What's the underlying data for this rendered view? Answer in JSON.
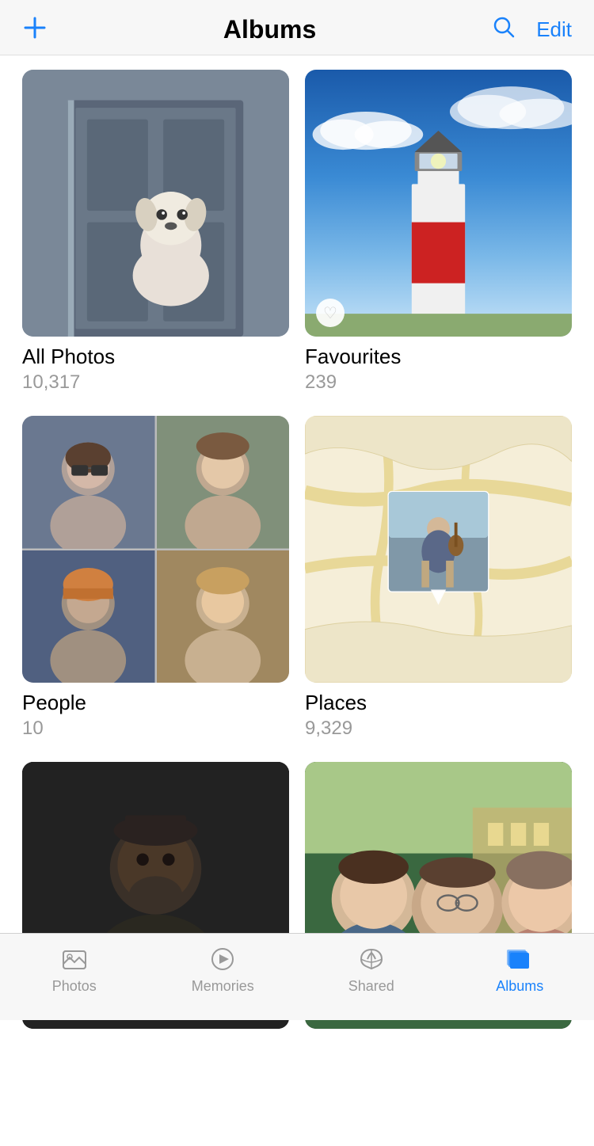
{
  "header": {
    "title": "Albums",
    "add_label": "+",
    "edit_label": "Edit"
  },
  "albums": [
    {
      "id": "all-photos",
      "name": "All Photos",
      "count": "10,317",
      "type": "dog"
    },
    {
      "id": "favourites",
      "name": "Favourites",
      "count": "239",
      "type": "lighthouse",
      "badge": "heart"
    },
    {
      "id": "people",
      "name": "People",
      "count": "10",
      "type": "people"
    },
    {
      "id": "places",
      "name": "Places",
      "count": "9,329",
      "type": "places"
    },
    {
      "id": "album5",
      "name": "",
      "count": "",
      "type": "dark"
    },
    {
      "id": "album6",
      "name": "",
      "count": "",
      "type": "group"
    }
  ],
  "tabs": [
    {
      "id": "photos",
      "label": "Photos",
      "active": false
    },
    {
      "id": "memories",
      "label": "Memories",
      "active": false
    },
    {
      "id": "shared",
      "label": "Shared",
      "active": false
    },
    {
      "id": "albums",
      "label": "Albums",
      "active": true
    }
  ]
}
